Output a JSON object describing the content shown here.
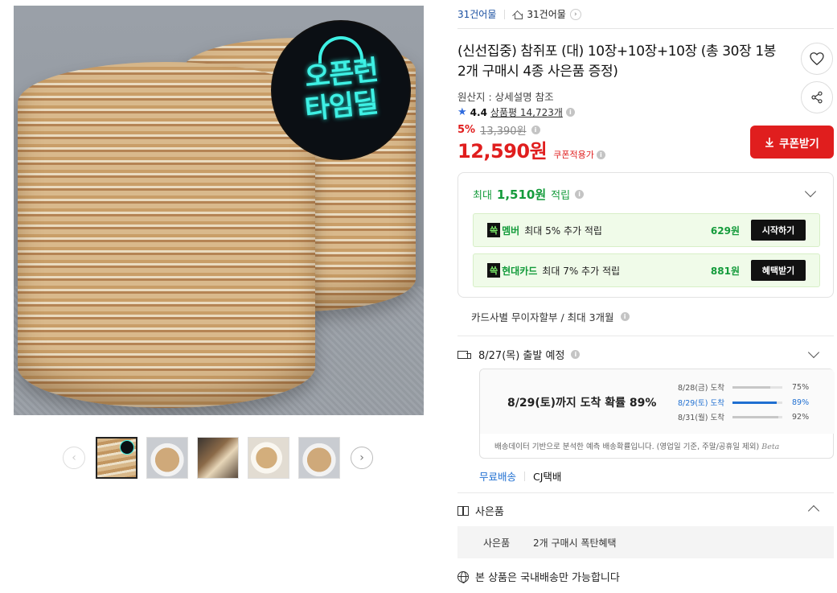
{
  "gallery": {
    "badge_line1": "오픈런",
    "badge_line2": "타임딜",
    "prev_icon": "chevron-left-icon",
    "next_icon": "chevron-right-icon",
    "thumbnail_count": 5,
    "active_thumbnail": 1
  },
  "seller": {
    "name": "31건어물",
    "store_name": "31건어물"
  },
  "product": {
    "title": "(신선집중) 참쥐포 (대) 10장+10장+10장 (총 30장 1봉 2개 구매시 4종 사은품 증정)",
    "origin": "원산지 : 상세설명 참조",
    "rating": "4.4",
    "review_label": "상품평 14,723개"
  },
  "price": {
    "discount": "5%",
    "original": "13,390원",
    "sale": "12,590",
    "sale_unit": "원",
    "coupon_note": "쿠폰적용가",
    "coupon_button": "쿠폰받기"
  },
  "reward": {
    "prefix": "최대",
    "amount": "1,510원",
    "suffix": "적립",
    "benefits": [
      {
        "tag": "쓱",
        "tag_word": "멤버",
        "text": "최대 5% 추가 적립",
        "amount": "629원",
        "button": "시작하기"
      },
      {
        "tag": "쓱",
        "tag_word": "현대카드",
        "text": "최대 7% 추가 적립",
        "amount": "881원",
        "button": "혜택받기"
      }
    ]
  },
  "installment": "카드사별 무이자할부 / 최대 3개월",
  "shipping": {
    "dispatch": "8/27(목) 출발 예정",
    "headline": "8/29(토)까지 도착 확률 89%",
    "forecast": [
      {
        "date": "8/28(금) 도착",
        "pct": "75%",
        "value": 0.75,
        "active": false
      },
      {
        "date": "8/29(토) 도착",
        "pct": "89%",
        "value": 0.89,
        "active": true
      },
      {
        "date": "8/31(월) 도착",
        "pct": "92%",
        "value": 0.92,
        "active": false
      }
    ],
    "footnote": "배송데이터 기반으로 분석한 예측 배송확률입니다. (영업일 기준, 주말/공휴일 제외)",
    "beta": "Beta",
    "free_label": "무료배송",
    "carrier": "CJ택배"
  },
  "gift": {
    "header": "사은품",
    "label": "사은품",
    "value": "2개 구매시 폭탄혜택"
  },
  "intl": "본 상품은 국내배송만 가능합니다",
  "colors": {
    "price_red": "#e01e1e",
    "reward_green": "#149b3b",
    "link_blue": "#1f6fd1"
  }
}
